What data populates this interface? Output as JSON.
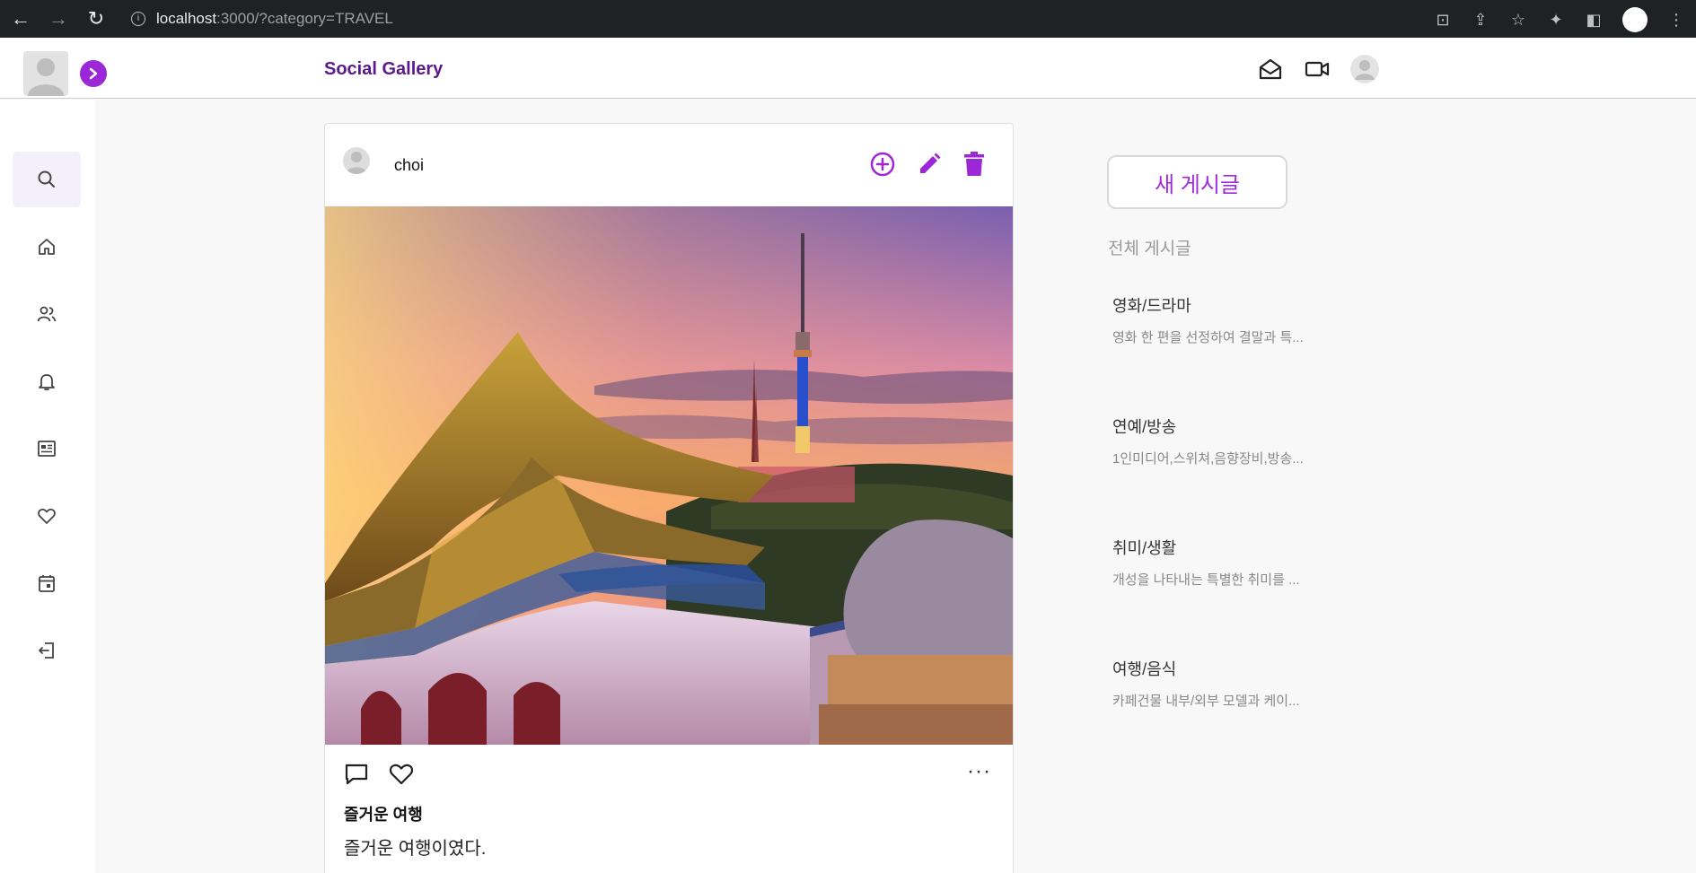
{
  "browser": {
    "url_host": "localhost",
    "url_rest": ":3000/?category=TRAVEL"
  },
  "header": {
    "brand": "Social Gallery"
  },
  "post": {
    "username": "choi",
    "title": "즐거운 여행",
    "body": "즐거운 여행이였다.",
    "more": "···"
  },
  "right_panel": {
    "new_post": "새 게시글",
    "all_posts": "전체 게시글",
    "categories": [
      {
        "title": "영화/드라마",
        "desc": "영화 한 편을 선정하여 결말과 특..."
      },
      {
        "title": "연예/방송",
        "desc": "1인미디어,스위쳐,음향장비,방송..."
      },
      {
        "title": "취미/생활",
        "desc": "개성을 나타내는 특별한 취미를 ..."
      },
      {
        "title": "여행/음식",
        "desc": "카페건물 내부/외부 모델과 케이..."
      }
    ]
  },
  "colors": {
    "accent": "#9c27d6",
    "brand": "#5a1a8c"
  }
}
